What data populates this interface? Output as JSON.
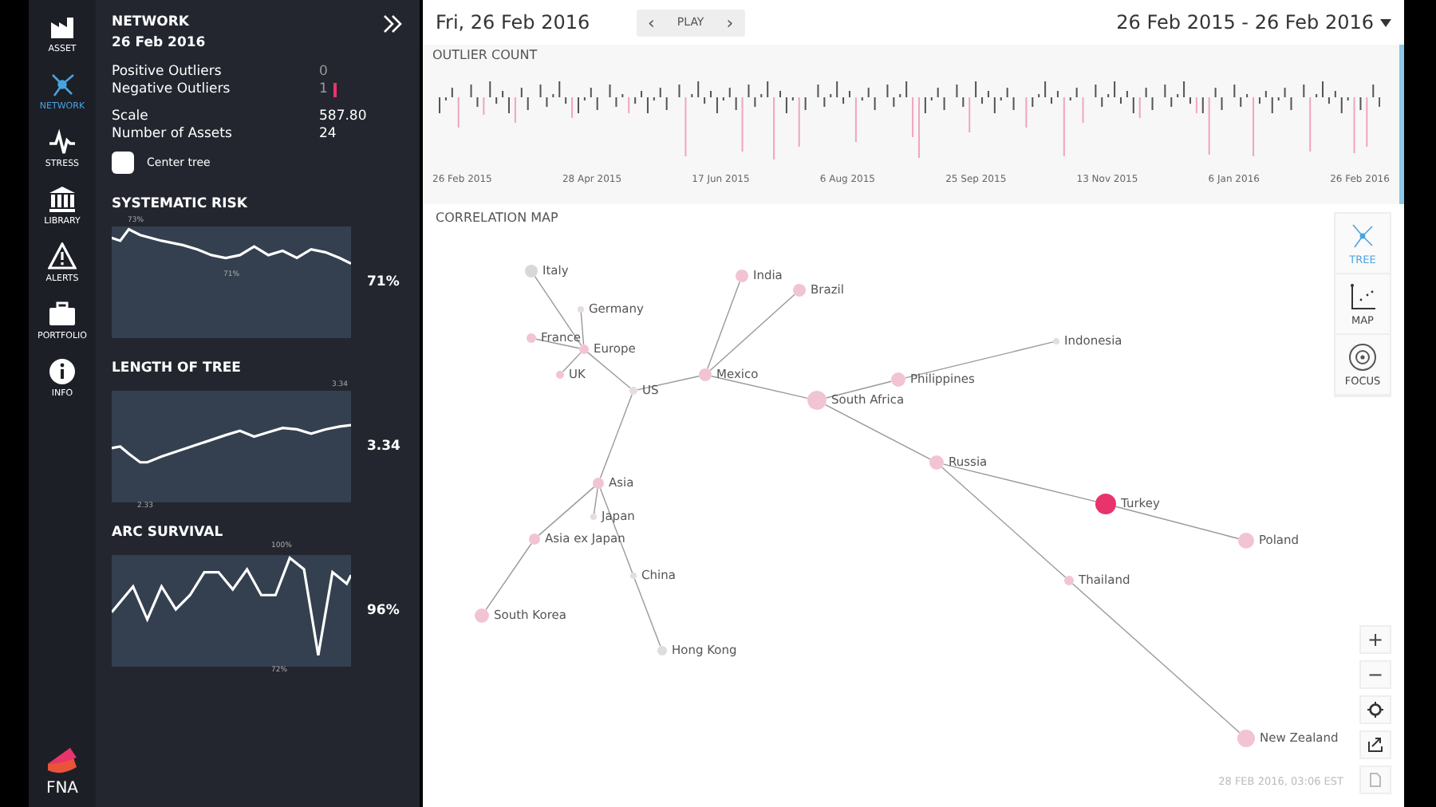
{
  "nav": [
    {
      "label": "ASSET",
      "selected": false
    },
    {
      "label": "NETWORK",
      "selected": true
    },
    {
      "label": "STRESS",
      "selected": false
    },
    {
      "label": "LIBRARY",
      "selected": false
    },
    {
      "label": "ALERTS",
      "selected": false
    },
    {
      "label": "PORTFOLIO",
      "selected": false
    },
    {
      "label": "INFO",
      "selected": false
    }
  ],
  "logo": "FNA",
  "panel": {
    "title": "NETWORK",
    "date": "26 Feb 2016",
    "stats": [
      {
        "label": "Positive Outliers",
        "value": "0"
      },
      {
        "label": "Negative Outliers",
        "value": "1"
      },
      {
        "label": "Scale",
        "value": "587.80"
      },
      {
        "label": "Number of Assets",
        "value": "24"
      }
    ],
    "center_tree": {
      "label": "Center tree",
      "checked": false
    },
    "metrics": [
      {
        "title": "SYSTEMATIC RISK",
        "value": "71%",
        "peak": "73%",
        "low": "71%"
      },
      {
        "title": "LENGTH OF TREE",
        "value": "3.34",
        "peak": "3.34",
        "low": "2.33"
      },
      {
        "title": "ARC SURVIVAL",
        "value": "96%",
        "peak": "100%",
        "low": "72%"
      }
    ]
  },
  "header": {
    "date": "Fri, 26 Feb 2016",
    "play": "PLAY",
    "prev": "‹",
    "next": "›",
    "range": "26 Feb 2015 - 26 Feb 2016"
  },
  "outlier_count": {
    "title": "OUTLIER COUNT",
    "dates": [
      "26 Feb 2015",
      "28 Apr 2015",
      "17 Jun 2015",
      "6 Aug 2015",
      "25 Sep 2015",
      "13 Nov 2015",
      "6 Jan 2016",
      "26 Feb 2016"
    ]
  },
  "correlation_map": {
    "title": "CORRELATION MAP",
    "timestamp": "28 FEB 2016, 03:06 EST",
    "views": [
      {
        "label": "TREE",
        "selected": true
      },
      {
        "label": "MAP",
        "selected": false
      },
      {
        "label": "FOCUS",
        "selected": false
      }
    ],
    "zoom_in": "+",
    "zoom_out": "−",
    "tree": {
      "label": "US",
      "color": "#e6dcdf",
      "children": [
        {
          "label": "Europe",
          "color": "#f2c4d3",
          "children": [
            {
              "label": "Italy",
              "color": "#d8d8d8"
            },
            {
              "label": "Germany",
              "color": "#e6dcdf"
            },
            {
              "label": "France",
              "color": "#f2c4d3"
            },
            {
              "label": "UK",
              "color": "#f2c4d3"
            }
          ]
        },
        {
          "label": "Mexico",
          "color": "#f2c4d3",
          "children": [
            {
              "label": "India",
              "color": "#f2c4d3"
            },
            {
              "label": "Brazil",
              "color": "#f2c4d3"
            },
            {
              "label": "South Africa",
              "color": "#f2c4d3",
              "children": [
                {
                  "label": "Philippines",
                  "color": "#f2c4d3",
                  "children": [
                    {
                      "label": "Indonesia",
                      "color": "#e6dcdf"
                    }
                  ]
                },
                {
                  "label": "Russia",
                  "color": "#f2c4d3",
                  "children": [
                    {
                      "label": "Turkey",
                      "color": "#e8336d",
                      "children": [
                        {
                          "label": "Poland",
                          "color": "#f2c4d3"
                        }
                      ]
                    },
                    {
                      "label": "Thailand",
                      "color": "#f2c4d3",
                      "children": [
                        {
                          "label": "New Zealand",
                          "color": "#f2c4d3"
                        }
                      ]
                    }
                  ]
                }
              ]
            }
          ]
        },
        {
          "label": "Asia",
          "color": "#f2c4d3",
          "children": [
            {
              "label": "Japan",
              "color": "#e6dcdf"
            },
            {
              "label": "Asia ex Japan",
              "color": "#f2c4d3",
              "children": [
                {
                  "label": "South Korea",
                  "color": "#f2c4d3"
                }
              ]
            },
            {
              "label": "China",
              "color": "#e6dcdf",
              "children": [
                {
                  "label": "Hong Kong",
                  "color": "#dddddd"
                }
              ]
            }
          ]
        }
      ]
    }
  }
}
